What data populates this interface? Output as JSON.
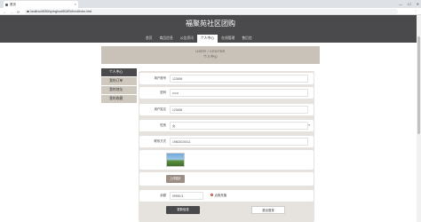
{
  "browser": {
    "tab_title": "首页",
    "tab_close": "×",
    "win_min": "—",
    "win_max": "☐",
    "win_close": "✕",
    "back": "←",
    "forward": "→",
    "reload": "⟳",
    "url": "localhost:8080/springboot563/Eb/front/index.html",
    "menu": "⋮"
  },
  "header": {
    "title": "福聚苑社区团购",
    "nav": [
      "首页",
      "商品信息",
      "公告资讯",
      "个人中心",
      "在线管理",
      "售后信"
    ]
  },
  "banner": {
    "en": "USER / CENTER",
    "cn": "个人中心"
  },
  "sidebar": {
    "items": [
      "个人中心",
      "我的订单",
      "我的地址",
      "我的收藏"
    ]
  },
  "form": {
    "account_label": "用户账号",
    "account_value": "123456",
    "password_label": "密码",
    "password_value": "••••••",
    "name_label": "用户姓名",
    "name_value": "123456",
    "gender_label": "性别",
    "gender_value": "女",
    "gender_arrow": "▾",
    "phone_label": "联系方式",
    "phone_value": "19802020011",
    "upload_label": "上传图片",
    "balance_label": "余额",
    "balance_value": "99990.5",
    "recharge_label": "点我充值"
  },
  "actions": {
    "update": "更新信息",
    "logout": "退出登录"
  }
}
